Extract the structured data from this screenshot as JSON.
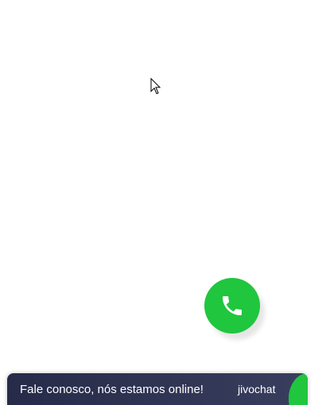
{
  "chat_widget": {
    "message": "Fale conosco, nós estamos online!",
    "brand": "jivochat"
  },
  "call_button": {
    "icon": "phone-icon"
  },
  "colors": {
    "accent_green": "#1fc63e",
    "bar_dark": "#262b49"
  }
}
